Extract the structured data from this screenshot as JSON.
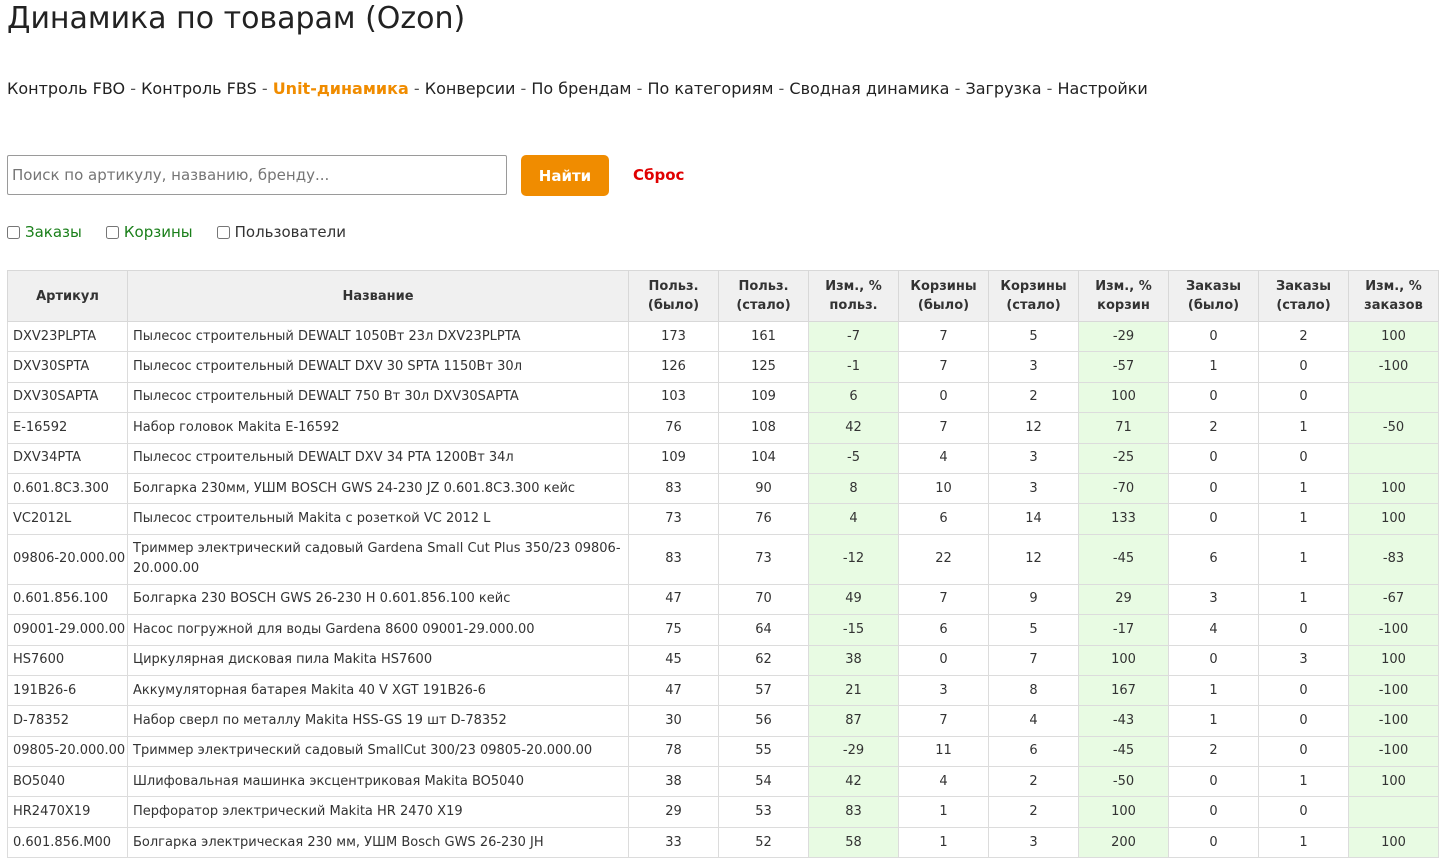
{
  "page_title": "Динамика по товарам (Ozon)",
  "nav": {
    "separator": " - ",
    "items": [
      {
        "label": "Контроль FBO",
        "active": false
      },
      {
        "label": "Контроль FBS",
        "active": false
      },
      {
        "label": "Unit-динамика",
        "active": true
      },
      {
        "label": "Конверсии",
        "active": false
      },
      {
        "label": "По брендам",
        "active": false
      },
      {
        "label": "По категориям",
        "active": false
      },
      {
        "label": "Сводная динамика",
        "active": false
      },
      {
        "label": "Загрузка",
        "active": false
      },
      {
        "label": "Настройки",
        "active": false
      }
    ]
  },
  "search": {
    "placeholder": "Поиск по артикулу, названию, бренду...",
    "value": "",
    "find_label": "Найти",
    "reset_label": "Сброс"
  },
  "filters": [
    {
      "label": "Заказы",
      "checked": false
    },
    {
      "label": "Корзины",
      "checked": false
    },
    {
      "label": "Пользователи",
      "checked": false
    }
  ],
  "colors": {
    "accent": "#f08c00",
    "reset": "#e00000",
    "highlight_cell": "#e8fbe3",
    "filter_green": "#1a7f1a"
  },
  "table": {
    "headers": [
      [
        "Артикул"
      ],
      [
        "Название"
      ],
      [
        "Польз.",
        "(было)"
      ],
      [
        "Польз.",
        "(стало)"
      ],
      [
        "Изм., %",
        "польз."
      ],
      [
        "Корзины",
        "(было)"
      ],
      [
        "Корзины",
        "(стало)"
      ],
      [
        "Изм., %",
        "корзин"
      ],
      [
        "Заказы",
        "(было)"
      ],
      [
        "Заказы",
        "(стало)"
      ],
      [
        "Изм., %",
        "заказов"
      ]
    ],
    "rows": [
      [
        "DXV23PLPTA",
        "Пылесос строительный DEWALT 1050Вт 23л DXV23PLPTA",
        "173",
        "161",
        "-7",
        "7",
        "5",
        "-29",
        "0",
        "2",
        "100"
      ],
      [
        "DXV30SPTA",
        "Пылесос строительный DEWALT DXV 30 SPTA 1150Вт 30л",
        "126",
        "125",
        "-1",
        "7",
        "3",
        "-57",
        "1",
        "0",
        "-100"
      ],
      [
        "DXV30SAPTA",
        "Пылесос строительный DEWALT 750 Вт 30л DXV30SAPTA",
        "103",
        "109",
        "6",
        "0",
        "2",
        "100",
        "0",
        "0",
        ""
      ],
      [
        "E-16592",
        "Набор головок Makita E-16592",
        "76",
        "108",
        "42",
        "7",
        "12",
        "71",
        "2",
        "1",
        "-50"
      ],
      [
        "DXV34PTA",
        "Пылесос строительный DEWALT DXV 34 PTA 1200Вт 34л",
        "109",
        "104",
        "-5",
        "4",
        "3",
        "-25",
        "0",
        "0",
        ""
      ],
      [
        "0.601.8C3.300",
        "Болгарка 230мм, УШМ BOSCH GWS 24-230 JZ 0.601.8C3.300 кейс",
        "83",
        "90",
        "8",
        "10",
        "3",
        "-70",
        "0",
        "1",
        "100"
      ],
      [
        "VC2012L",
        "Пылесос строительный Makita с розеткой VC 2012 L",
        "73",
        "76",
        "4",
        "6",
        "14",
        "133",
        "0",
        "1",
        "100"
      ],
      [
        "09806-20.000.00",
        "Триммер электрический садовый Gardena Small Cut Plus 350/23 09806-20.000.00",
        "83",
        "73",
        "-12",
        "22",
        "12",
        "-45",
        "6",
        "1",
        "-83"
      ],
      [
        "0.601.856.100",
        "Болгарка 230 BOSCH GWS 26-230 H 0.601.856.100 кейс",
        "47",
        "70",
        "49",
        "7",
        "9",
        "29",
        "3",
        "1",
        "-67"
      ],
      [
        "09001-29.000.00",
        "Насос погружной для воды Gardena 8600 09001-29.000.00",
        "75",
        "64",
        "-15",
        "6",
        "5",
        "-17",
        "4",
        "0",
        "-100"
      ],
      [
        "HS7600",
        "Циркулярная дисковая пила Makita HS7600",
        "45",
        "62",
        "38",
        "0",
        "7",
        "100",
        "0",
        "3",
        "100"
      ],
      [
        "191B26-6",
        "Аккумуляторная батарея Makita 40 V XGT 191B26-6",
        "47",
        "57",
        "21",
        "3",
        "8",
        "167",
        "1",
        "0",
        "-100"
      ],
      [
        "D-78352",
        "Набор сверл по металлу Makita HSS-GS 19 шт D-78352",
        "30",
        "56",
        "87",
        "7",
        "4",
        "-43",
        "1",
        "0",
        "-100"
      ],
      [
        "09805-20.000.00",
        "Триммер электрический садовый SmallCut 300/23 09805-20.000.00",
        "78",
        "55",
        "-29",
        "11",
        "6",
        "-45",
        "2",
        "0",
        "-100"
      ],
      [
        "BO5040",
        "Шлифовальная машинка эксцентриковая Makita BO5040",
        "38",
        "54",
        "42",
        "4",
        "2",
        "-50",
        "0",
        "1",
        "100"
      ],
      [
        "HR2470X19",
        "Перфоратор электрический Makita HR 2470 X19",
        "29",
        "53",
        "83",
        "1",
        "2",
        "100",
        "0",
        "0",
        ""
      ],
      [
        "0.601.856.M00",
        "Болгарка электрическая 230 мм, УШМ Bosch GWS 26-230 JH",
        "33",
        "52",
        "58",
        "1",
        "3",
        "200",
        "0",
        "1",
        "100"
      ]
    ],
    "tall_rows": [
      7
    ]
  }
}
